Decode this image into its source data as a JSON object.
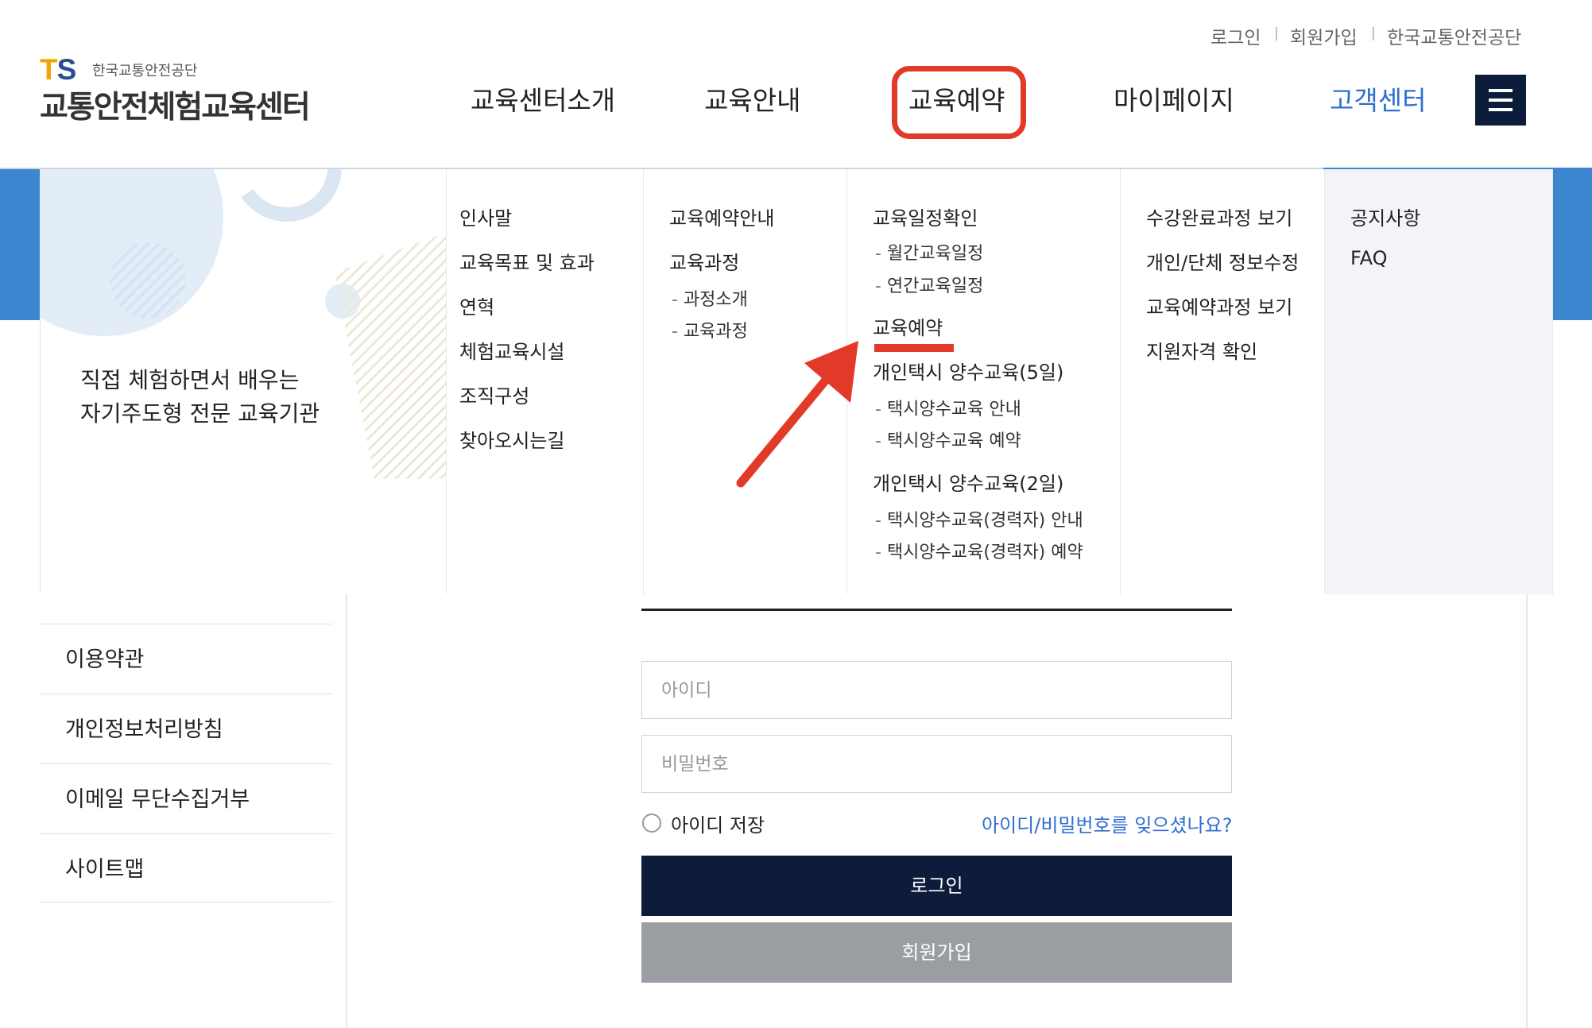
{
  "header": {
    "util_links": [
      "로그인",
      "회원가입",
      "한국교통안전공단"
    ],
    "logo": {
      "mark": "TS",
      "org": "한국교통안전공단",
      "title": "교통안전체험교육센터"
    },
    "gnb": [
      {
        "label": "교육센터소개"
      },
      {
        "label": "교육안내"
      },
      {
        "label": "교육예약"
      },
      {
        "label": "마이페이지"
      },
      {
        "label": "고객센터"
      }
    ],
    "menu_icon": "hamburger-icon"
  },
  "mega_menu": {
    "slogan_line1": "직접 체험하면서 배우는",
    "slogan_line2": "자기주도형 전문 교육기관",
    "col1": [
      "인사말",
      "교육목표 및 효과",
      "연혁",
      "체험교육시설",
      "조직구성",
      "찾아오시는길"
    ],
    "col2": {
      "items": [
        "교육예약안내",
        "교육과정"
      ],
      "subs": [
        "과정소개",
        "교육과정"
      ]
    },
    "col3": {
      "schedule": "교육일정확인",
      "schedule_subs": [
        "월간교육일정",
        "연간교육일정"
      ],
      "reserve": "교육예약",
      "taxi5": "개인택시 양수교육(5일)",
      "taxi5_subs": [
        "택시양수교육 안내",
        "택시양수교육 예약"
      ],
      "taxi2": "개인택시 양수교육(2일)",
      "taxi2_subs": [
        "택시양수교육(경력자) 안내",
        "택시양수교육(경력자) 예약"
      ]
    },
    "col4": [
      "수강완료과정 보기",
      "개인/단체 정보수정",
      "교육예약과정 보기",
      "지원자격 확인"
    ],
    "col5": [
      "공지사항",
      "FAQ"
    ]
  },
  "side_nav": [
    "이용약관",
    "개인정보처리방침",
    "이메일 무단수집거부",
    "사이트맵"
  ],
  "login": {
    "id_placeholder": "아이디",
    "pw_placeholder": "비밀번호",
    "save_id": "아이디 저장",
    "find_link": "아이디/비밀번호를 잊으셨나요?",
    "login_button": "로그인",
    "join_button": "회원가입"
  },
  "colors": {
    "accent": "#2f6fd1",
    "navy": "#0d1c3a",
    "annotation": "#e23a28"
  }
}
